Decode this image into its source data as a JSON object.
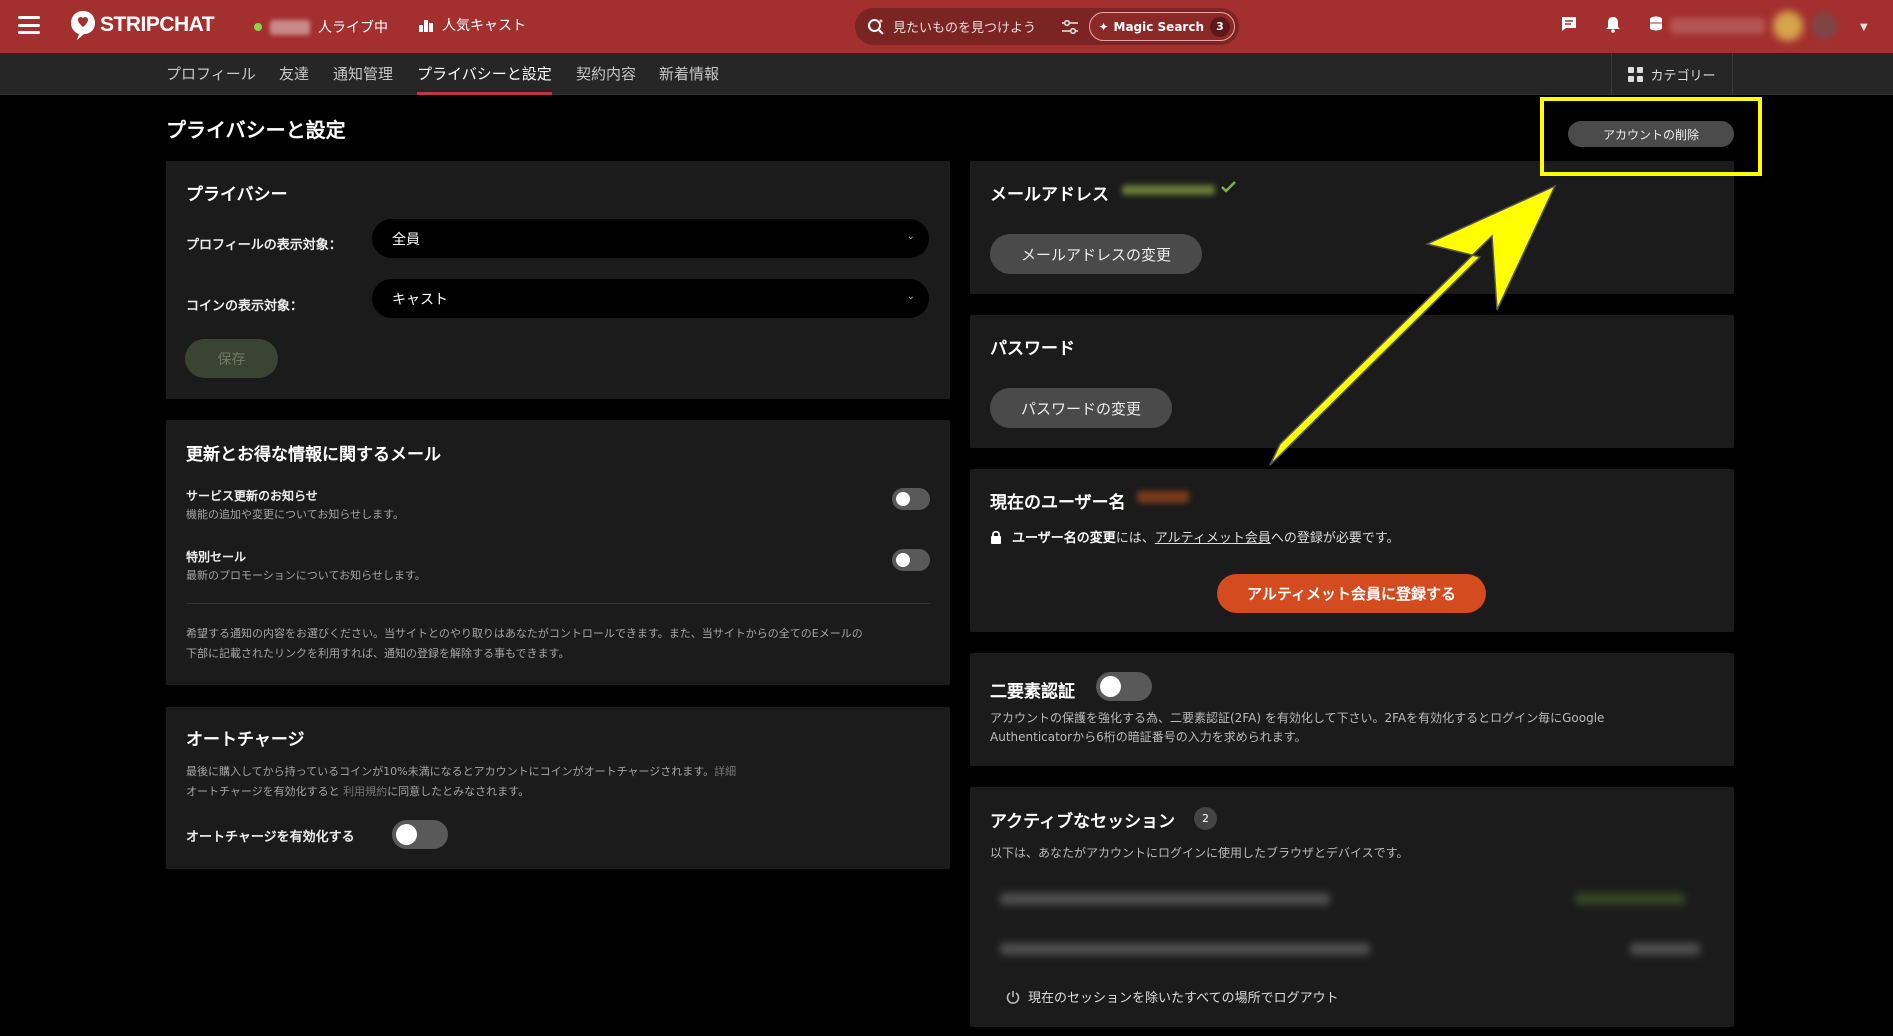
{
  "header": {
    "brand": "STRIPCHAT",
    "live_suffix": "人ライブ中",
    "popular_label": "人気キャスト",
    "search_placeholder": "見たいものを見つけよう",
    "magic_label": "Magic Search",
    "magic_count": "3",
    "accent_color": "#a3302f"
  },
  "subnav": {
    "tabs": [
      "プロフィール",
      "友達",
      "通知管理",
      "プライバシーと設定",
      "契約内容",
      "新着情報"
    ],
    "active_tab": "プライバシーと設定",
    "category_label": "カテゴリー"
  },
  "page": {
    "title": "プライバシーと設定",
    "delete_account": "アカウントの削除"
  },
  "privacy": {
    "title": "プライバシー",
    "profile_label": "プロフィールの表示対象：",
    "profile_value": "全員",
    "coin_label": "コインの表示対象：",
    "coin_value": "キャスト",
    "save": "保存"
  },
  "emails": {
    "title": "更新とお得な情報に関するメール",
    "service_title": "サービス更新のお知らせ",
    "service_desc": "機能の追加や変更についてお知らせします。",
    "sale_title": "特別セール",
    "sale_desc": "最新のプロモーションについてお知らせします。",
    "note_line1": "希望する通知の内容をお選びください。当サイトとのやり取りはあなたがコントロールできます。また、当サイトからの全てのEメールの",
    "note_line2": "下部に記載されたリンクを利用すれば、通知の登録を解除する事もできます。"
  },
  "autocharge": {
    "title": "オートチャージ",
    "desc1": "最後に購入してから持っているコインが10%未満になるとアカウントにコインがオートチャージされます。",
    "desc1_link": "詳細",
    "desc2_pre": "オートチャージを有効化すると ",
    "desc2_link": "利用規約",
    "desc2_post": "に同意したとみなされます。",
    "toggle_label": "オートチャージを有効化する"
  },
  "email_panel": {
    "title": "メールアドレス",
    "change": "メールアドレスの変更"
  },
  "password_panel": {
    "title": "パスワード",
    "change": "パスワードの変更"
  },
  "username_panel": {
    "title": "現在のユーザー名",
    "msg_bold": "ユーザー名の変更",
    "msg_mid": "には、",
    "msg_link": "アルティメット会員",
    "msg_end": "への登録が必要です。",
    "cta": "アルティメット会員に登録する"
  },
  "twofa": {
    "title": "二要素認証",
    "desc_line1": "アカウントの保護を強化する為、二要素認証(2FA) を有効化して下さい。2FAを有効化するとログイン毎にGoogle",
    "desc_line2": "Authenticatorから6桁の暗証番号の入力を求められます。"
  },
  "sessions": {
    "title": "アクティブなセッション",
    "count": "2",
    "desc": "以下は、あなたがアカウントにログインに使用したブラウザとデバイスです。",
    "logout_all": "現在のセッションを除いたすべての場所でログアウト"
  }
}
